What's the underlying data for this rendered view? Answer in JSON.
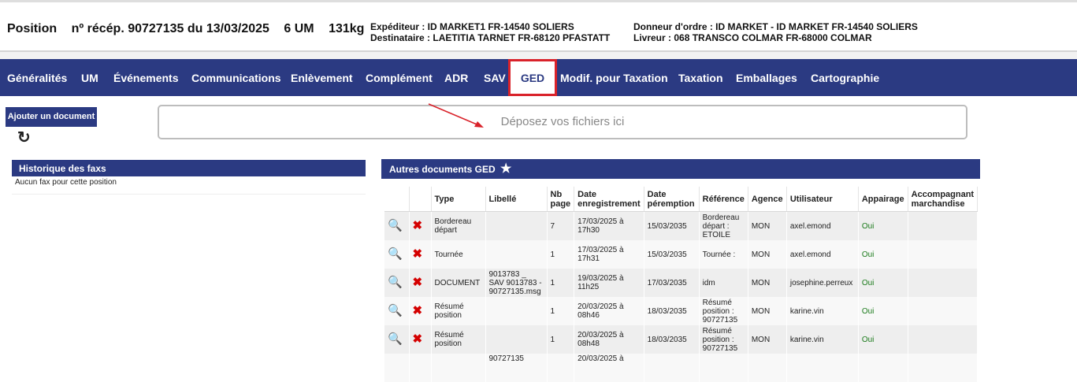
{
  "header": {
    "position": "Position",
    "reception": "nº récép. 90727135 du 13/03/2025",
    "um": "6 UM",
    "weight": "131kg",
    "expediteur": "Expéditeur : ID MARKET1 FR-14540 SOLIERS",
    "destinataire": "Destinataire : LAETITIA TARNET FR-68120 PFASTATT",
    "donneur": "Donneur d'ordre : ID MARKET - ID MARKET FR-14540 SOLIERS",
    "livreur": "Livreur : 068 TRANSCO COLMAR FR-68000 COLMAR"
  },
  "nav": {
    "items": [
      "Généralités",
      "UM",
      "Événements",
      "Communications",
      "Enlèvement",
      "Complément",
      "ADR",
      "SAV",
      "GED",
      "Modif. pour Taxation",
      "Taxation",
      "Emballages",
      "Cartographie"
    ],
    "active": "GED"
  },
  "actions": {
    "add_document": "Ajouter un document",
    "refresh_icon": "refresh-icon"
  },
  "dropzone": {
    "label": "Déposez vos fichiers ici"
  },
  "fax": {
    "title": "Historique des faxs",
    "empty": "Aucun fax pour cette position"
  },
  "docs": {
    "title": "Autres documents GED",
    "star_icon": "star-icon",
    "columns": [
      "Type",
      "Libellé",
      "Nb page",
      "Date enregistrement",
      "Date péremption",
      "Référence",
      "Agence",
      "Utilisateur",
      "Appairage",
      "Accompagnant marchandise"
    ],
    "rows": [
      {
        "type": "Bordereau départ",
        "libelle": "",
        "nb": "7",
        "date_enr": "17/03/2025 à 17h30",
        "date_per": "15/03/2035",
        "ref": "Bordereau départ : ETOILE",
        "agence": "MON",
        "user": "axel.emond",
        "appairage": "Oui",
        "accomp": ""
      },
      {
        "type": "Tournée",
        "libelle": "",
        "nb": "1",
        "date_enr": "17/03/2025 à 17h31",
        "date_per": "15/03/2035",
        "ref": "Tournée :",
        "agence": "MON",
        "user": "axel.emond",
        "appairage": "Oui",
        "accomp": ""
      },
      {
        "type": "DOCUMENT",
        "libelle": "9013783 _ SAV 9013783 - 90727135.msg",
        "nb": "1",
        "date_enr": "19/03/2025 à 11h25",
        "date_per": "17/03/2035",
        "ref": "idm",
        "agence": "MON",
        "user": "josephine.perreux",
        "appairage": "Oui",
        "accomp": ""
      },
      {
        "type": "Résumé position",
        "libelle": "",
        "nb": "1",
        "date_enr": "20/03/2025 à 08h46",
        "date_per": "18/03/2035",
        "ref": "Résumé position : 90727135",
        "agence": "MON",
        "user": "karine.vin",
        "appairage": "Oui",
        "accomp": ""
      },
      {
        "type": "Résumé position",
        "libelle": "",
        "nb": "1",
        "date_enr": "20/03/2025 à 08h48",
        "date_per": "18/03/2035",
        "ref": "Résumé position : 90727135",
        "agence": "MON",
        "user": "karine.vin",
        "appairage": "Oui",
        "accomp": ""
      },
      {
        "type": "",
        "libelle": "90727135",
        "nb": "",
        "date_enr": "20/03/2025 à",
        "date_per": "",
        "ref": "",
        "agence": "",
        "user": "",
        "appairage": "",
        "accomp": ""
      }
    ]
  },
  "colors": {
    "nav_bg": "#2b3a82",
    "active_outline": "#d9222a",
    "oui": "#1a7a1a",
    "delete": "#d40000"
  }
}
